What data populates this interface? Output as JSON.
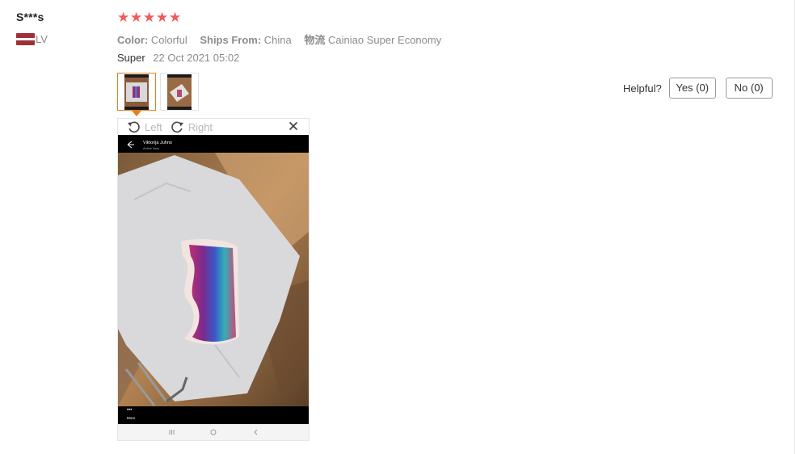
{
  "reviewer": {
    "name": "S***s",
    "country_code": "LV",
    "flag_colors": [
      "#9e3039",
      "#ffffff",
      "#9e3039"
    ]
  },
  "rating": {
    "stars": 5,
    "max": 5,
    "color": "#f05a5a"
  },
  "attributes": [
    {
      "label": "Color:",
      "value": "Colorful"
    },
    {
      "label": "Ships From:",
      "value": "China"
    },
    {
      "label": "物流",
      "value": "Cainiao Super Economy"
    }
  ],
  "review": {
    "text": "Super",
    "date": "22 Oct 2021 05:02"
  },
  "thumbnails": [
    {
      "icon": "photo-thumbnail-1",
      "selected": true
    },
    {
      "icon": "photo-thumbnail-2",
      "selected": false
    }
  ],
  "helpful": {
    "label": "Helpful?",
    "yes": "Yes (0)",
    "no": "No (0)"
  },
  "viewer": {
    "rotate_left": "Left",
    "rotate_right": "Right",
    "close_icon": "close-icon",
    "photo_header_name": "Viktorija Juhno",
    "photo_header_status": "Active Now",
    "photo_footer_dots": "•••",
    "photo_footer_label": "More"
  },
  "colors": {
    "accent": "#e67e22",
    "star": "#f05a5a",
    "muted": "#8c8c8c"
  }
}
